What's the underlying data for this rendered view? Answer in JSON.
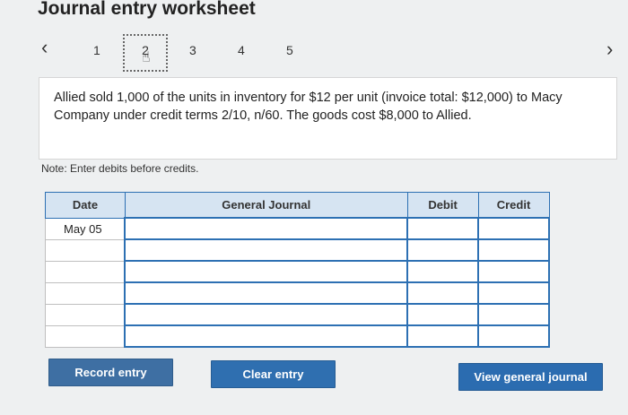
{
  "header": {
    "title": "Journal entry worksheet"
  },
  "nav": {
    "prev_icon": "chevron-left-icon",
    "next_icon": "chevron-right-icon",
    "pages": [
      "1",
      "2",
      "3",
      "4",
      "5"
    ],
    "current_page": "2"
  },
  "problem": {
    "text": "Allied sold 1,000 of the units in inventory for $12 per unit (invoice total: $12,000) to Macy Company under credit terms 2/10, n/60. The goods cost $8,000 to Allied."
  },
  "note": "Note: Enter debits before credits.",
  "table": {
    "headers": {
      "date": "Date",
      "general_journal": "General Journal",
      "debit": "Debit",
      "credit": "Credit"
    },
    "rows": [
      {
        "date": "May 05"
      },
      {
        "date": ""
      },
      {
        "date": ""
      },
      {
        "date": ""
      },
      {
        "date": ""
      },
      {
        "date": ""
      }
    ]
  },
  "buttons": {
    "record": "Record entry",
    "clear": "Clear entry",
    "view": "View general journal"
  },
  "colors": {
    "accent": "#2d70b3",
    "header_bg": "#d6e4f2",
    "button_bg": "#2f6fb0"
  }
}
